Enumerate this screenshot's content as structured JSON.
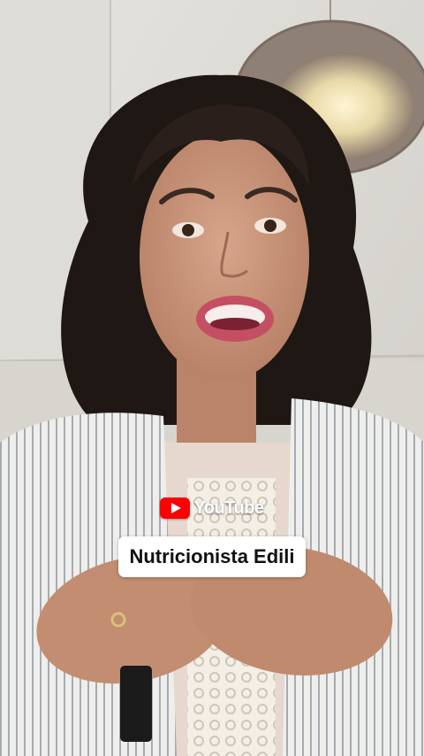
{
  "video": {
    "scene": "woman-speaking-to-camera"
  },
  "watermark": {
    "logo_icon": "youtube-play-icon",
    "logo_text": "YouTube",
    "logo_color": "#ff0000"
  },
  "channel": {
    "name": "Nutricionista Edili"
  }
}
